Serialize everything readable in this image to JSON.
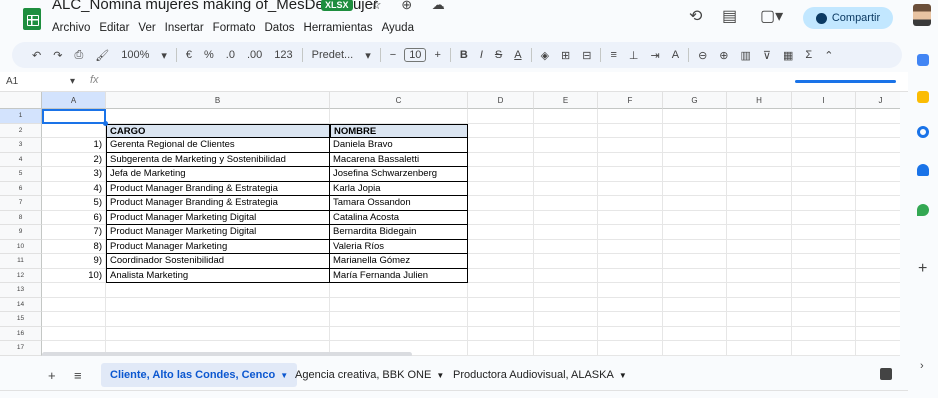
{
  "doc": {
    "title": "ALC_Nómina mujeres making of_MesDeLaMujer",
    "badge": "XLSX",
    "title_icons": "☆ ⊕ ☁"
  },
  "menu": [
    "Archivo",
    "Editar",
    "Ver",
    "Insertar",
    "Formato",
    "Datos",
    "Herramientas",
    "Ayuda"
  ],
  "share": {
    "label": "Compartir"
  },
  "toolbar": {
    "zoom": "100%",
    "currency": "€",
    "percent": "%",
    "dec_less": ".0",
    "dec_more": ".00",
    "num_format": "123",
    "font": "Predet...",
    "font_size": "10",
    "bold": "B",
    "italic": "I",
    "strike": "S",
    "text_color": "A"
  },
  "formula": {
    "cell_ref": "A1",
    "fx": "fx"
  },
  "columns": [
    "A",
    "B",
    "C",
    "D",
    "E",
    "F",
    "G",
    "H",
    "I",
    "J"
  ],
  "rows": [
    "1",
    "2",
    "3",
    "4",
    "5",
    "6",
    "7",
    "8",
    "9",
    "10",
    "11",
    "12",
    "13",
    "14",
    "15",
    "16",
    "17"
  ],
  "table": {
    "header_cargo": "CARGO",
    "header_nombre": "NOMBRE",
    "entries": [
      {
        "n": "1)",
        "cargo": "Gerenta Regional de Clientes",
        "nombre": "Daniela Bravo"
      },
      {
        "n": "2)",
        "cargo": "Subgerenta de Marketing y Sostenibilidad",
        "nombre": "Macarena Bassaletti"
      },
      {
        "n": "3)",
        "cargo": "Jefa de Marketing",
        "nombre": "Josefina Schwarzenberg"
      },
      {
        "n": "4)",
        "cargo": "Product Manager Branding & Estrategia",
        "nombre": "Karla Jopia"
      },
      {
        "n": "5)",
        "cargo": "Product Manager Branding & Estrategia",
        "nombre": "Tamara Ossandon"
      },
      {
        "n": "6)",
        "cargo": "Product Manager Marketing Digital",
        "nombre": "Catalina Acosta"
      },
      {
        "n": "7)",
        "cargo": "Product Manager Marketing Digital",
        "nombre": "Bernardita Bidegain"
      },
      {
        "n": "8)",
        "cargo": "Product Manager Marketing",
        "nombre": "Valeria Ríos"
      },
      {
        "n": "9)",
        "cargo": "Coordinador Sostenibilidad",
        "nombre": "Marianella Gómez"
      },
      {
        "n": "10)",
        "cargo": "Analista Marketing",
        "nombre": "María Fernanda Julien"
      }
    ]
  },
  "sheets": [
    {
      "label": "Cliente, Alto las Condes, Cenco",
      "active": true
    },
    {
      "label": "Agencia creativa, BBK ONE",
      "active": false
    },
    {
      "label": "Productora Audiovisual, ALASKA",
      "active": false
    }
  ],
  "colors": {
    "accent": "#1a73e8",
    "share_bg": "#c2e7ff",
    "header_fill": "#dbe5f1",
    "sheets_green": "#1e8e3e"
  }
}
